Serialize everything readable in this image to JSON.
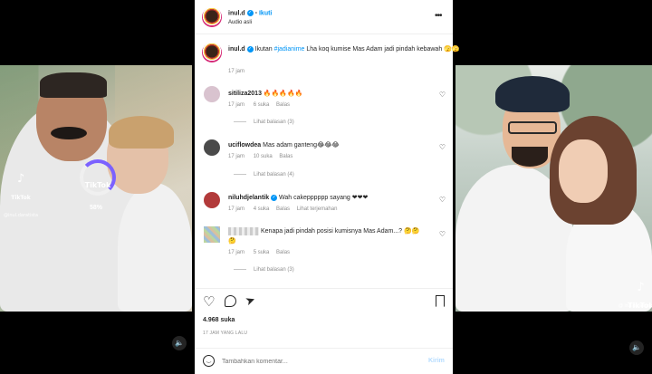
{
  "header": {
    "username": "inul.d",
    "follow_label": "Ikuti",
    "audio_label": "Audio asli"
  },
  "caption": {
    "username": "inul.d",
    "text": "Ikutan ",
    "hashtag": "#jadianime",
    "text2": " Lha koq kumise Mas Adam jadi pindah kebawah 🫣🫣",
    "time": "17 jam"
  },
  "comments": [
    {
      "username": "sitiliza2013",
      "text": "🔥🔥🔥🔥🔥",
      "time": "17 jam",
      "likes": "6 suka",
      "reply": "Balas",
      "replies": "Lihat balasan (3)",
      "translate": ""
    },
    {
      "username": "uciflowdea",
      "text": "Mas adam ganteng😂😂😂",
      "time": "17 jam",
      "likes": "10 suka",
      "reply": "Balas",
      "replies": "Lihat balasan (4)",
      "translate": ""
    },
    {
      "username": "niluhdjelantik",
      "text": "Wah cakepppppp sayang ❤❤❤",
      "time": "17 jam",
      "likes": "4 suka",
      "reply": "Balas",
      "replies": "",
      "translate": "Lihat terjemahan"
    },
    {
      "username": "",
      "text": "Kenapa jadi pindah posisi kumisnya Mas Adam...? 🤔🤔",
      "text2": "🤔",
      "time": "17 jam",
      "likes": "5 suka",
      "reply": "Balas",
      "replies": "Lihat balasan (3)",
      "translate": ""
    }
  ],
  "actions": {
    "likes": "4.968 suka",
    "timestamp": "17 JAM YANG LALU"
  },
  "composer": {
    "placeholder": "Tambahkan komentar...",
    "post_label": "Kirim"
  },
  "left_media": {
    "tiktok_label": "TikTok",
    "progress": "58%",
    "tiktok_small": "TikTok",
    "handle": "@inul.daratista"
  },
  "right_media": {
    "tiktok_label": "TikTok",
    "handle": "@ inul.daratista"
  },
  "icons": [
    "heart-icon",
    "comment-icon",
    "share-icon",
    "bookmark-icon",
    "more-icon",
    "emoji-icon",
    "sound-icon"
  ],
  "colors": {
    "accent": "#0095f6",
    "background": "#000000",
    "panel": "#ffffff"
  }
}
